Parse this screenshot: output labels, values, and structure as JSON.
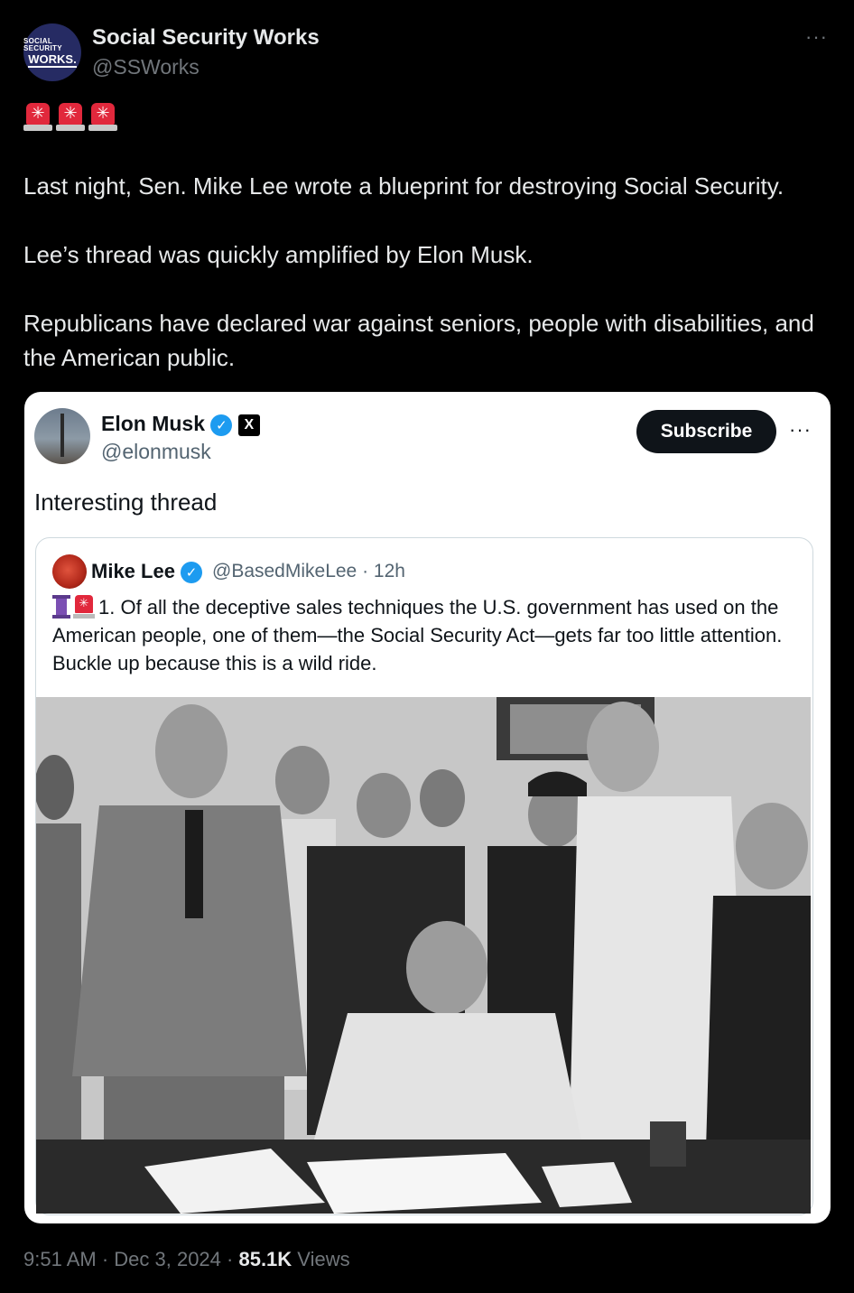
{
  "post": {
    "author_name": "Social Security Works",
    "author_handle": "@SSWorks",
    "avatar_text_top": "SOCIAL SECURITY",
    "avatar_text_bottom": "WORKS.",
    "more": "···",
    "paragraphs": [
      "Last night, Sen. Mike Lee wrote a blueprint for destroying Social Security.",
      "Lee’s thread was quickly amplified by Elon Musk.",
      "Republicans have declared war against seniors, people with disabilities, and the American public."
    ],
    "timestamp": "9:51 AM · Dec 3, 2024 · ",
    "views_count": "85.1K",
    "views_label": " Views"
  },
  "quote": {
    "author_name": "Elon Musk",
    "author_handle": "@elonmusk",
    "verified_glyph": "✓",
    "x_badge": "X",
    "subscribe_label": "Subscribe",
    "more": "···",
    "text": "Interesting thread",
    "nested": {
      "author_name": "Mike Lee",
      "verified_glyph": "✓",
      "handle_time": "@BasedMikeLee · 12h",
      "text": "1. Of all the deceptive sales techniques the U.S. government has used on the American people, one of them—the Social Security Act—gets far too little attention. Buckle up because this is a wild ride."
    }
  },
  "colors": {
    "background": "#000000",
    "text": "#e7e9ea",
    "muted": "#71767b",
    "verified": "#1d9bf0",
    "siren": "#e1283c"
  }
}
